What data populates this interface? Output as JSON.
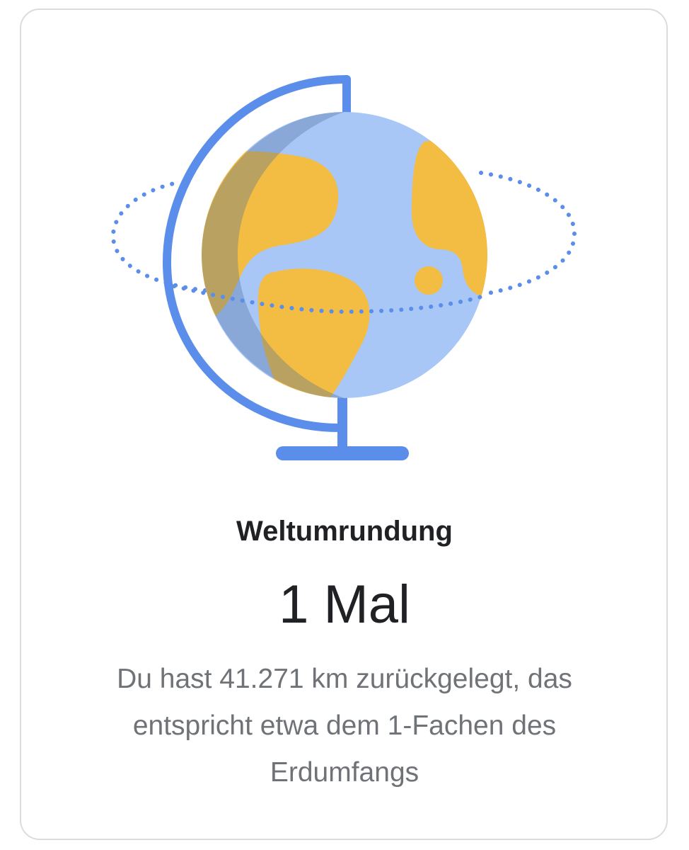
{
  "achievement": {
    "title": "Weltumrundung",
    "value": "1 Mal",
    "description": "Du hast 41.271 km zurückgelegt, das entspricht etwa dem 1-Fachen des Erdumfangs",
    "icon": "globe-icon"
  },
  "colors": {
    "stand": "#5a8eea",
    "ocean": "#a8c7f7",
    "land": "#f2bd42",
    "shadow": "#4f6f9a",
    "orbit": "#5a8eea"
  }
}
